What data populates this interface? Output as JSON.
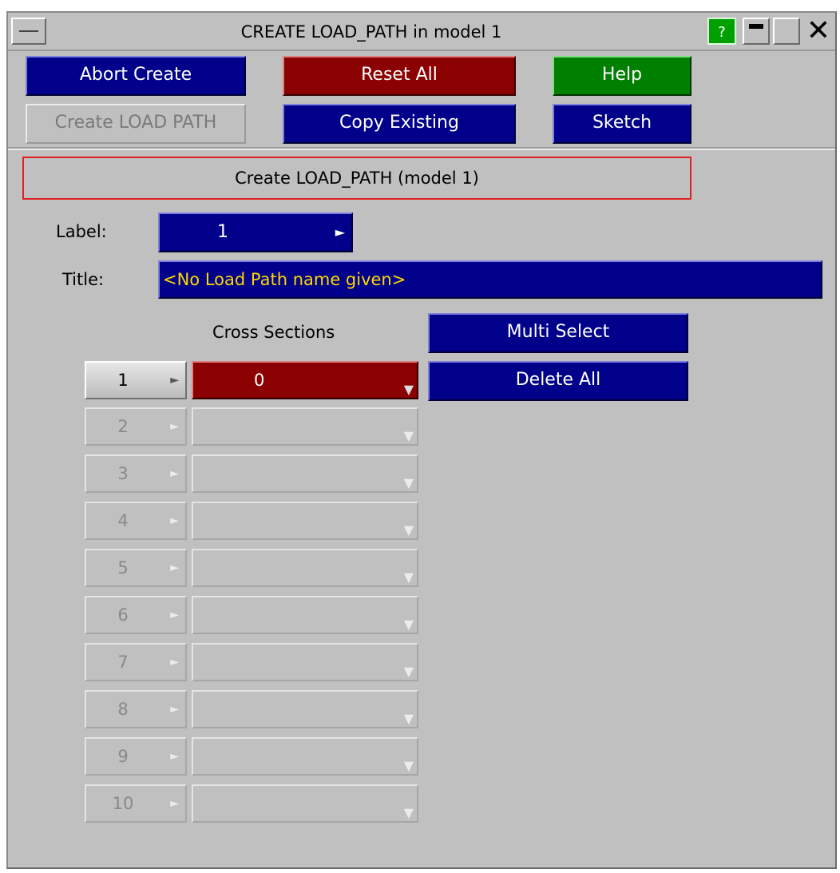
{
  "window": {
    "title": "CREATE LOAD_PATH in model 1",
    "help_symbol": "?",
    "close_symbol": "✕"
  },
  "toolbar": {
    "abort_create": "Abort Create",
    "reset_all": "Reset All",
    "help": "Help",
    "create_load_path": "Create LOAD PATH",
    "copy_existing": "Copy Existing",
    "sketch": "Sketch"
  },
  "form": {
    "header": "Create LOAD_PATH (model 1)",
    "label_caption": "Label:",
    "label_value": "1",
    "title_caption": "Title:",
    "title_value": "<No Load Path name given>"
  },
  "cross_sections": {
    "heading": "Cross Sections",
    "multi_select": "Multi Select",
    "delete_all": "Delete All",
    "rows": [
      {
        "index": "1",
        "value": "0",
        "enabled": true
      },
      {
        "index": "2",
        "value": "",
        "enabled": false
      },
      {
        "index": "3",
        "value": "",
        "enabled": false
      },
      {
        "index": "4",
        "value": "",
        "enabled": false
      },
      {
        "index": "5",
        "value": "",
        "enabled": false
      },
      {
        "index": "6",
        "value": "",
        "enabled": false
      },
      {
        "index": "7",
        "value": "",
        "enabled": false
      },
      {
        "index": "8",
        "value": "",
        "enabled": false
      },
      {
        "index": "9",
        "value": "",
        "enabled": false
      },
      {
        "index": "10",
        "value": "",
        "enabled": false
      }
    ]
  },
  "colors": {
    "button_blue": "#00008b",
    "button_red": "#8b0000",
    "button_green": "#008000",
    "panel_gray": "#c0c0c0",
    "title_text_yellow": "#ffd700",
    "header_border_red": "#e02020"
  }
}
